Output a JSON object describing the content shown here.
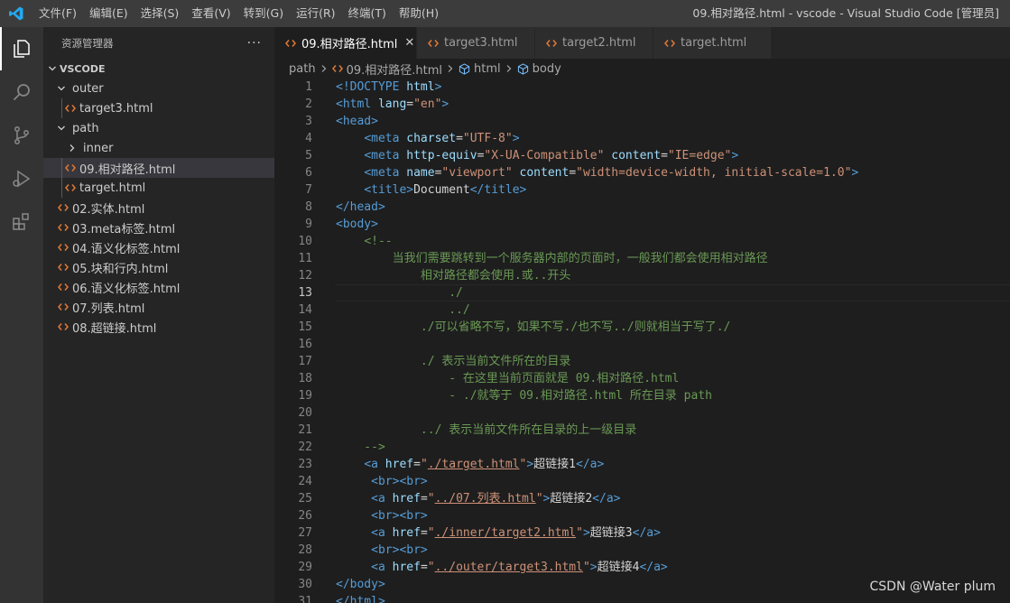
{
  "menu": [
    "文件(F)",
    "编辑(E)",
    "选择(S)",
    "查看(V)",
    "转到(G)",
    "运行(R)",
    "终端(T)",
    "帮助(H)"
  ],
  "window_title": "09.相对路径.html - vscode - Visual Studio Code [管理员]",
  "sidebar": {
    "title": "资源管理器",
    "more": "···",
    "root": "VSCODE",
    "tree": [
      {
        "label": "outer",
        "kind": "folder-open",
        "indent": 1
      },
      {
        "label": "target3.html",
        "kind": "file",
        "indent": 2
      },
      {
        "label": "path",
        "kind": "folder-open",
        "indent": 1
      },
      {
        "label": "inner",
        "kind": "folder-closed",
        "indent": 2
      },
      {
        "label": "09.相对路径.html",
        "kind": "file",
        "indent": 2,
        "selected": true
      },
      {
        "label": "target.html",
        "kind": "file",
        "indent": 2
      },
      {
        "label": "02.实体.html",
        "kind": "file",
        "indent": 1
      },
      {
        "label": "03.meta标签.html",
        "kind": "file",
        "indent": 1
      },
      {
        "label": "04.语义化标签.html",
        "kind": "file",
        "indent": 1
      },
      {
        "label": "05.块和行内.html",
        "kind": "file",
        "indent": 1
      },
      {
        "label": "06.语义化标签.html",
        "kind": "file",
        "indent": 1
      },
      {
        "label": "07.列表.html",
        "kind": "file",
        "indent": 1
      },
      {
        "label": "08.超链接.html",
        "kind": "file",
        "indent": 1
      }
    ]
  },
  "tabs": [
    {
      "label": "09.相对路径.html",
      "active": true,
      "close": "✕"
    },
    {
      "label": "target3.html",
      "active": false
    },
    {
      "label": "target2.html",
      "active": false
    },
    {
      "label": "target.html",
      "active": false
    }
  ],
  "breadcrumb": [
    "path",
    "09.相对路径.html",
    "html",
    "body"
  ],
  "editor": {
    "current_line": 13,
    "lines": [
      {
        "n": "1",
        "t": [
          [
            "tag",
            "<!DOCTYPE "
          ],
          [
            "attr",
            "html"
          ],
          [
            "tag",
            ">"
          ]
        ]
      },
      {
        "n": "2",
        "t": [
          [
            "tag",
            "<html "
          ],
          [
            "attr",
            "lang"
          ],
          [
            "text",
            "="
          ],
          [
            "str",
            "\"en\""
          ],
          [
            "tag",
            ">"
          ]
        ]
      },
      {
        "n": "3",
        "t": [
          [
            "tag",
            "<head>"
          ]
        ]
      },
      {
        "n": "4",
        "t": [
          [
            "text",
            "    "
          ],
          [
            "tag",
            "<meta "
          ],
          [
            "attr",
            "charset"
          ],
          [
            "text",
            "="
          ],
          [
            "str",
            "\"UTF-8\""
          ],
          [
            "tag",
            ">"
          ]
        ]
      },
      {
        "n": "5",
        "t": [
          [
            "text",
            "    "
          ],
          [
            "tag",
            "<meta "
          ],
          [
            "attr",
            "http-equiv"
          ],
          [
            "text",
            "="
          ],
          [
            "str",
            "\"X-UA-Compatible\""
          ],
          [
            "text",
            " "
          ],
          [
            "attr",
            "content"
          ],
          [
            "text",
            "="
          ],
          [
            "str",
            "\"IE=edge\""
          ],
          [
            "tag",
            ">"
          ]
        ]
      },
      {
        "n": "6",
        "t": [
          [
            "text",
            "    "
          ],
          [
            "tag",
            "<meta "
          ],
          [
            "attr",
            "name"
          ],
          [
            "text",
            "="
          ],
          [
            "str",
            "\"viewport\""
          ],
          [
            "text",
            " "
          ],
          [
            "attr",
            "content"
          ],
          [
            "text",
            "="
          ],
          [
            "str",
            "\"width=device-width, initial-scale=1.0\""
          ],
          [
            "tag",
            ">"
          ]
        ]
      },
      {
        "n": "7",
        "t": [
          [
            "text",
            "    "
          ],
          [
            "tag",
            "<title>"
          ],
          [
            "text",
            "Document"
          ],
          [
            "tag",
            "</title>"
          ]
        ]
      },
      {
        "n": "8",
        "t": [
          [
            "tag",
            "</head>"
          ]
        ]
      },
      {
        "n": "9",
        "t": [
          [
            "tag",
            "<body>"
          ]
        ]
      },
      {
        "n": "10",
        "t": [
          [
            "text",
            "    "
          ],
          [
            "cmt",
            "<!--"
          ]
        ]
      },
      {
        "n": "11",
        "t": [
          [
            "cmt",
            "        当我们需要跳转到一个服务器内部的页面时，一般我们都会使用相对路径"
          ]
        ]
      },
      {
        "n": "12",
        "t": [
          [
            "cmt",
            "            相对路径都会使用.或..开头"
          ]
        ]
      },
      {
        "n": "13",
        "t": [
          [
            "cmt",
            "                ./"
          ]
        ]
      },
      {
        "n": "14",
        "t": [
          [
            "cmt",
            "                ../"
          ]
        ]
      },
      {
        "n": "15",
        "t": [
          [
            "cmt",
            "            ./可以省略不写，如果不写./也不写../则就相当于写了./"
          ]
        ]
      },
      {
        "n": "16",
        "t": [
          [
            "cmt",
            ""
          ]
        ]
      },
      {
        "n": "17",
        "t": [
          [
            "cmt",
            "            ./ 表示当前文件所在的目录"
          ]
        ]
      },
      {
        "n": "18",
        "t": [
          [
            "cmt",
            "                - 在这里当前页面就是 09.相对路径.html"
          ]
        ]
      },
      {
        "n": "19",
        "t": [
          [
            "cmt",
            "                - ./就等于 09.相对路径.html 所在目录 path"
          ]
        ]
      },
      {
        "n": "20",
        "t": [
          [
            "cmt",
            ""
          ]
        ]
      },
      {
        "n": "21",
        "t": [
          [
            "cmt",
            "            ../ 表示当前文件所在目录的上一级目录"
          ]
        ]
      },
      {
        "n": "22",
        "t": [
          [
            "cmt",
            "    -->"
          ]
        ]
      },
      {
        "n": "23",
        "t": [
          [
            "text",
            "    "
          ],
          [
            "tag",
            "<a "
          ],
          [
            "attr",
            "href"
          ],
          [
            "text",
            "="
          ],
          [
            "str",
            "\""
          ],
          [
            "strul",
            "./target.html"
          ],
          [
            "str",
            "\""
          ],
          [
            "tag",
            ">"
          ],
          [
            "text",
            "超链接1"
          ],
          [
            "tag",
            "</a>"
          ]
        ]
      },
      {
        "n": "24",
        "t": [
          [
            "text",
            "     "
          ],
          [
            "tag",
            "<br><br>"
          ]
        ]
      },
      {
        "n": "25",
        "t": [
          [
            "text",
            "     "
          ],
          [
            "tag",
            "<a "
          ],
          [
            "attr",
            "href"
          ],
          [
            "text",
            "="
          ],
          [
            "str",
            "\""
          ],
          [
            "strul",
            "../07.列表.html"
          ],
          [
            "str",
            "\""
          ],
          [
            "tag",
            ">"
          ],
          [
            "text",
            "超链接2"
          ],
          [
            "tag",
            "</a>"
          ]
        ]
      },
      {
        "n": "26",
        "t": [
          [
            "text",
            "     "
          ],
          [
            "tag",
            "<br><br>"
          ]
        ]
      },
      {
        "n": "27",
        "t": [
          [
            "text",
            "     "
          ],
          [
            "tag",
            "<a "
          ],
          [
            "attr",
            "href"
          ],
          [
            "text",
            "="
          ],
          [
            "str",
            "\""
          ],
          [
            "strul",
            "./inner/target2.html"
          ],
          [
            "str",
            "\""
          ],
          [
            "tag",
            ">"
          ],
          [
            "text",
            "超链接3"
          ],
          [
            "tag",
            "</a>"
          ]
        ]
      },
      {
        "n": "28",
        "t": [
          [
            "text",
            "     "
          ],
          [
            "tag",
            "<br><br>"
          ]
        ]
      },
      {
        "n": "29",
        "t": [
          [
            "text",
            "     "
          ],
          [
            "tag",
            "<a "
          ],
          [
            "attr",
            "href"
          ],
          [
            "text",
            "="
          ],
          [
            "str",
            "\""
          ],
          [
            "strul",
            "../outer/target3.html"
          ],
          [
            "str",
            "\""
          ],
          [
            "tag",
            ">"
          ],
          [
            "text",
            "超链接4"
          ],
          [
            "tag",
            "</a>"
          ]
        ]
      },
      {
        "n": "30",
        "t": [
          [
            "tag",
            "</body>"
          ]
        ]
      },
      {
        "n": "31",
        "t": [
          [
            "tag",
            "</html>"
          ]
        ]
      }
    ]
  },
  "watermark": "CSDN @Water plum",
  "colors": {
    "tag": "#569cd6",
    "attr": "#9cdcfe",
    "str": "#ce9178",
    "text": "#d4d4d4",
    "comment": "#6a9955",
    "html_icon": "#e37933",
    "accent": "#007acc"
  }
}
